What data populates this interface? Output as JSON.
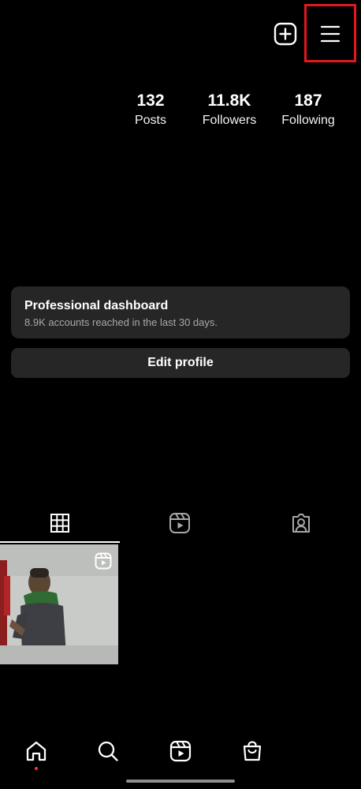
{
  "stats": {
    "posts": {
      "value": "132",
      "label": "Posts"
    },
    "followers": {
      "value": "11.8K",
      "label": "Followers"
    },
    "following": {
      "value": "187",
      "label": "Following"
    }
  },
  "dashboard": {
    "title": "Professional dashboard",
    "subtitle": "8.9K accounts reached in the last 30 days."
  },
  "edit_profile": {
    "label": "Edit profile"
  },
  "header_icons": [
    "new-post-icon",
    "menu-icon"
  ],
  "tabs": [
    {
      "name": "posts-grid",
      "icon": "grid-icon",
      "selected": true
    },
    {
      "name": "reels",
      "icon": "reels-icon",
      "selected": false
    },
    {
      "name": "tagged",
      "icon": "tagged-icon",
      "selected": false
    }
  ],
  "bottom_nav": [
    {
      "name": "home",
      "icon": "home-icon",
      "active": true
    },
    {
      "name": "search",
      "icon": "search-icon",
      "active": false
    },
    {
      "name": "reels",
      "icon": "reels-icon",
      "active": false
    },
    {
      "name": "shop",
      "icon": "shop-icon",
      "active": false
    }
  ],
  "colors": {
    "background": "#000000",
    "card": "#262626",
    "subtext": "#a8a8a8",
    "notification_dot": "#ff3040",
    "highlight_box": "#e0181f"
  }
}
